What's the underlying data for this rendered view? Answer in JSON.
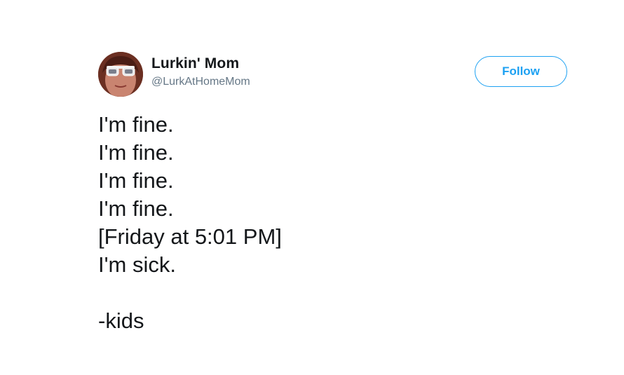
{
  "tweet": {
    "author": {
      "display_name": "Lurkin' Mom",
      "handle": "@LurkAtHomeMom",
      "avatar_icon": "user-avatar-photo"
    },
    "follow_label": "Follow",
    "lines": [
      "I'm fine.",
      "I'm fine.",
      "I'm fine.",
      "I'm fine.",
      "[Friday at 5:01 PM]",
      "I'm sick.",
      "",
      "-kids"
    ]
  },
  "colors": {
    "accent": "#1da1f2",
    "text": "#14171a",
    "secondary_text": "#657786",
    "background": "#ffffff"
  }
}
